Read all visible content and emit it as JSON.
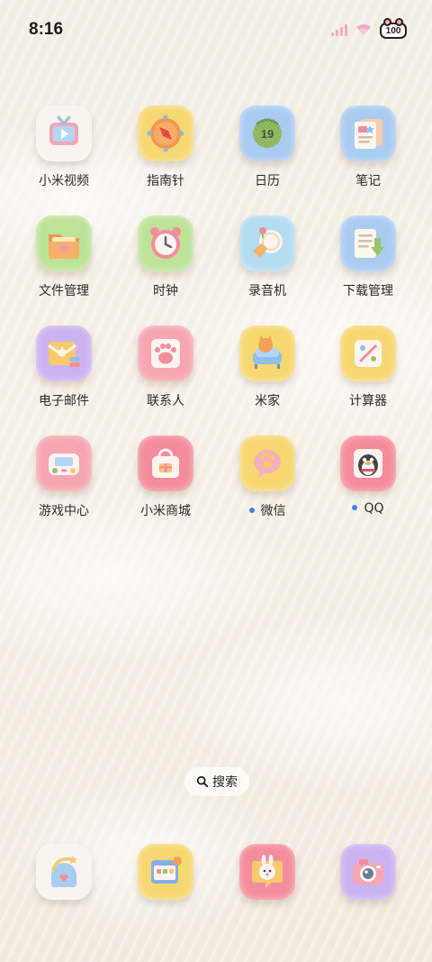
{
  "status_bar": {
    "time": "8:16",
    "battery_level": "100",
    "signal_color": "#f1a9c0",
    "wifi_color": "#f1a9c0"
  },
  "apps": [
    {
      "label": "小米视频",
      "icon": "video-icon",
      "tile_color": "#f7f2ec",
      "notification_dot": false
    },
    {
      "label": "指南针",
      "icon": "compass-icon",
      "tile_color": "#f6d25e",
      "notification_dot": false
    },
    {
      "label": "日历",
      "icon": "calendar-icon",
      "tile_color": "#9ec5ef",
      "notification_dot": false,
      "date_text": "19"
    },
    {
      "label": "笔记",
      "icon": "notes-icon",
      "tile_color": "#9ec5ef",
      "notification_dot": false
    },
    {
      "label": "文件管理",
      "icon": "folder-icon",
      "tile_color": "#b4df8a",
      "notification_dot": false
    },
    {
      "label": "时钟",
      "icon": "clock-icon",
      "tile_color": "#b4df8a",
      "notification_dot": false
    },
    {
      "label": "录音机",
      "icon": "recorder-icon",
      "tile_color": "#a9d8ef",
      "notification_dot": false
    },
    {
      "label": "下载管理",
      "icon": "download-icon",
      "tile_color": "#9ec5ef",
      "notification_dot": false
    },
    {
      "label": "电子邮件",
      "icon": "email-icon",
      "tile_color": "#c3a9ee",
      "notification_dot": false
    },
    {
      "label": "联系人",
      "icon": "contacts-icon",
      "tile_color": "#f59aa7",
      "notification_dot": false
    },
    {
      "label": "米家",
      "icon": "mijia-icon",
      "tile_color": "#f6d25e",
      "notification_dot": false
    },
    {
      "label": "计算器",
      "icon": "calculator-icon",
      "tile_color": "#f6d25e",
      "notification_dot": false
    },
    {
      "label": "游戏中心",
      "icon": "gamepad-icon",
      "tile_color": "#f59aa7",
      "notification_dot": false
    },
    {
      "label": "小米商城",
      "icon": "shop-icon",
      "tile_color": "#f27d8e",
      "notification_dot": false
    },
    {
      "label": "微信",
      "icon": "wechat-icon",
      "tile_color": "#f6d25e",
      "notification_dot": true
    },
    {
      "label": "QQ",
      "icon": "qq-penguin-icon",
      "tile_color": "#f27d8e",
      "notification_dot": true
    }
  ],
  "search": {
    "label": "搜索"
  },
  "dock": [
    {
      "icon": "phone-icon",
      "tile_color": "#f7f2ec"
    },
    {
      "icon": "messages-icon",
      "tile_color": "#f6d25e"
    },
    {
      "icon": "browser-bunny-icon",
      "tile_color": "#f27d8e"
    },
    {
      "icon": "camera-icon",
      "tile_color": "#c3a9ee"
    }
  ]
}
